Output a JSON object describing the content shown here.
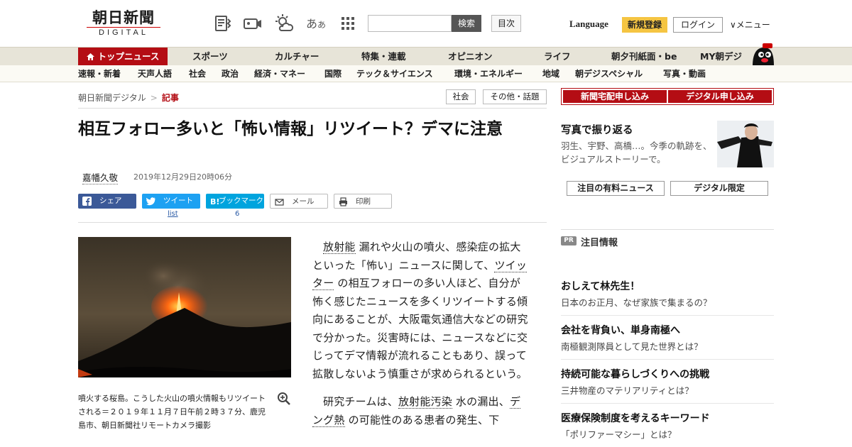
{
  "header": {
    "logo_main": "朝日新聞",
    "logo_sub": "DIGITAL",
    "aa_label": "あ",
    "aa_small": "あ",
    "search_button": "検索",
    "toc_button": "目次",
    "language": "Language",
    "signup": "新規登録",
    "login": "ログイン",
    "menu": "∨メニュー"
  },
  "nav_primary": {
    "active": "トップニュース",
    "items": [
      "スポーツ",
      "カルチャー",
      "特集・連載",
      "オピニオン",
      "ライフ",
      "朝夕刊紙面・be",
      "MY朝デジ"
    ]
  },
  "nav_secondary": {
    "items": [
      "速報・新着",
      "天声人語",
      "社会",
      "政治",
      "経済・マネー",
      "国際",
      "テック＆サイエンス",
      "環境・エネルギー",
      "地域",
      "朝デジスペシャル",
      "写真・動画"
    ]
  },
  "breadcrumb": {
    "home": "朝日新聞デジタル",
    "sep": ">",
    "current": "記事"
  },
  "tags": [
    "社会",
    "その他・話題"
  ],
  "article": {
    "title": "相互フォロー多いと「怖い情報」リツイート？デマに注意",
    "author": "嘉幡久敬",
    "date": "2019年12月29日20時06分",
    "share": {
      "facebook": "シェア",
      "twitter": "ツイート",
      "twitter_count": "list",
      "hatena": "ブックマーク",
      "hatena_count": "6",
      "mail": "メール",
      "print": "印刷"
    },
    "caption": "噴火する桜島。こうした火山の噴火情報もリツイートされる＝２０１９年１１月７日午前２時３７分、鹿児島市、朝日新聞社リモートカメラ撮影",
    "p1_kw1": "放射能",
    "p1_text1": " 漏れや火山の噴火、感染症の拡大といった「怖い」ニュースに関して、",
    "p1_kw2": "ツイッター",
    "p1_text2": " の相互フォローの多い人ほど、自分が怖く感じたニュースを多くリツイートする傾向にあることが、大阪電気通信大などの研究で分かった。災害時には、ニュースなどに交じってデマ情報が流れることもあり、誤って拡散しないよう慎重さが求められるという。",
    "p2_text1": "研究チームは、",
    "p2_kw1": "放射能汚染",
    "p2_text2": " 水の漏出、",
    "p2_kw2": "デング熱",
    "p2_text3": " の可能性のある患者の発生、下"
  },
  "sidebar": {
    "subscribe_paper": "新聞宅配申し込み",
    "subscribe_digital": "デジタル申し込み",
    "photo_title": "写真で振り返る",
    "photo_desc": "羽生、宇野、高橋…。今季の軌跡を、ビジュアルストーリーで。",
    "tab_paid": "注目の有料ニュース",
    "tab_digital": "デジタル限定",
    "pr_badge": "PR",
    "pr_heading": "注目情報",
    "pr_items": [
      {
        "title": "おしえて林先生！",
        "desc": "日本のお正月、なぜ家族で集まるの？"
      },
      {
        "title": "会社を背負い、単身南極へ",
        "desc": "南極観測隊員として見た世界とは？"
      },
      {
        "title": "持続可能な暮らしづくりへの挑戦",
        "desc": "三井物産のマテリアリティとは？"
      },
      {
        "title": "医療保険制度を考えるキーワード",
        "desc": "「ポリファーマシー」とは？"
      }
    ]
  },
  "colors": {
    "brand_red": "#b40d14",
    "facebook": "#3b5998",
    "twitter": "#1da1f2",
    "hatena": "#00a4de",
    "signup_yellow": "#f5c542"
  }
}
